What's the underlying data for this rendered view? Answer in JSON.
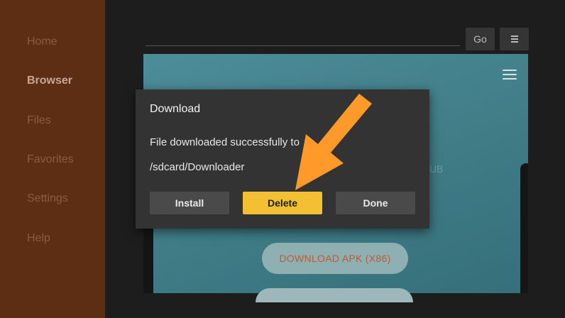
{
  "sidebar": {
    "items": [
      {
        "label": "Home",
        "active": false
      },
      {
        "label": "Browser",
        "active": true
      },
      {
        "label": "Files",
        "active": false
      },
      {
        "label": "Favorites",
        "active": false
      },
      {
        "label": "Settings",
        "active": false
      },
      {
        "label": "Help",
        "active": false
      }
    ]
  },
  "toolbar": {
    "go_label": "Go",
    "menu_icon": "hamburger-menu-icon"
  },
  "webpage": {
    "faint_text": "UB",
    "download_button_label": "DOWNLOAD APK (X86)",
    "menu_icon": "hamburger-icon"
  },
  "dialog": {
    "title": "Download",
    "message_line1": "File downloaded successfully to",
    "message_line2": "/sdcard/Downloader",
    "install_label": "Install",
    "delete_label": "Delete",
    "done_label": "Done"
  },
  "colors": {
    "sidebar_bg": "#5e2e14",
    "accent_yellow": "#f4c033",
    "arrow_orange": "#ff9a2a",
    "dialog_bg": "#333333"
  }
}
